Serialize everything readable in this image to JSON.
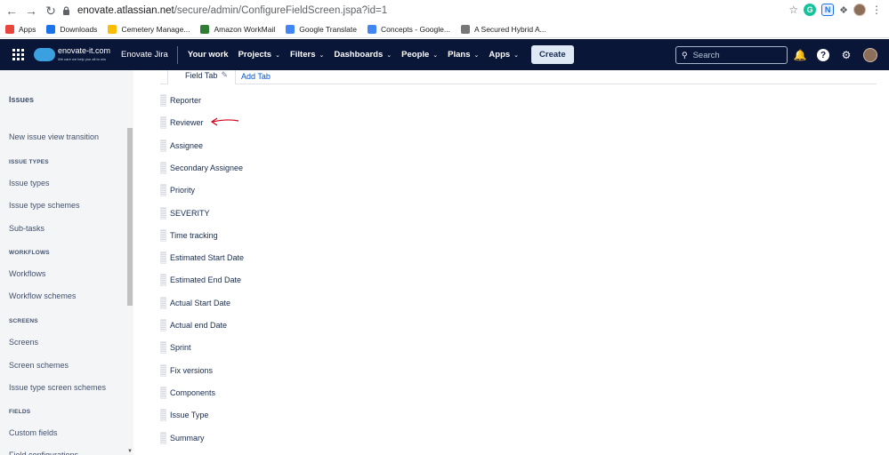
{
  "browser": {
    "url_host": "enovate.atlassian.net",
    "url_path": "/secure/admin/ConfigureFieldScreen.jspa?id=1",
    "bookmarks": [
      {
        "label": "Apps",
        "icon": "apps-grid-icon",
        "color": "#e8453c"
      },
      {
        "label": "Downloads",
        "icon": "download-icon",
        "color": "#1a73e8"
      },
      {
        "label": "Cemetery Manage...",
        "icon": "google-drive-icon",
        "color": "#fbbc04"
      },
      {
        "label": "Amazon WorkMail",
        "icon": "mail-icon",
        "color": "#2e7d32"
      },
      {
        "label": "Google Translate",
        "icon": "translate-icon",
        "color": "#4285f4"
      },
      {
        "label": "Concepts - Google...",
        "icon": "google-docs-icon",
        "color": "#4285f4"
      },
      {
        "label": "A Secured Hybrid A...",
        "icon": "globe-icon",
        "color": "#777777"
      }
    ]
  },
  "jira": {
    "site_logo_text": "enovate-it.com",
    "site_logo_subtext": "We care we help you all to win",
    "site_name": "Enovate Jira",
    "nav": [
      {
        "label": "Your work",
        "dropdown": false
      },
      {
        "label": "Projects",
        "dropdown": true
      },
      {
        "label": "Filters",
        "dropdown": true
      },
      {
        "label": "Dashboards",
        "dropdown": true
      },
      {
        "label": "People",
        "dropdown": true
      },
      {
        "label": "Plans",
        "dropdown": true
      },
      {
        "label": "Apps",
        "dropdown": true
      }
    ],
    "create_label": "Create",
    "search_placeholder": "Search"
  },
  "sidebar": {
    "title": "Issues",
    "items": [
      {
        "type": "item",
        "label": "New issue view transition"
      },
      {
        "type": "heading",
        "label": "ISSUE TYPES"
      },
      {
        "type": "item",
        "label": "Issue types"
      },
      {
        "type": "item",
        "label": "Issue type schemes"
      },
      {
        "type": "item",
        "label": "Sub-tasks"
      },
      {
        "type": "heading",
        "label": "WORKFLOWS"
      },
      {
        "type": "item",
        "label": "Workflows"
      },
      {
        "type": "item",
        "label": "Workflow schemes"
      },
      {
        "type": "heading",
        "label": "SCREENS"
      },
      {
        "type": "item",
        "label": "Screens"
      },
      {
        "type": "item",
        "label": "Screen schemes"
      },
      {
        "type": "item",
        "label": "Issue type screen schemes"
      },
      {
        "type": "heading",
        "label": "FIELDS"
      },
      {
        "type": "item",
        "label": "Custom fields"
      },
      {
        "type": "item",
        "label": "Field configurations"
      }
    ]
  },
  "main": {
    "tab_label": "Field Tab",
    "add_tab_label": "Add Tab",
    "fields": [
      "Reporter",
      "Reviewer",
      "Assignee",
      "Secondary Assignee",
      "Priority",
      "SEVERITY",
      "Time tracking",
      "Estimated Start Date",
      "Estimated End Date",
      "Actual Start Date",
      "Actual end Date",
      "Sprint",
      "Fix versions",
      "Components",
      "Issue Type",
      "Summary"
    ],
    "annotation_color": "#d0021b"
  }
}
